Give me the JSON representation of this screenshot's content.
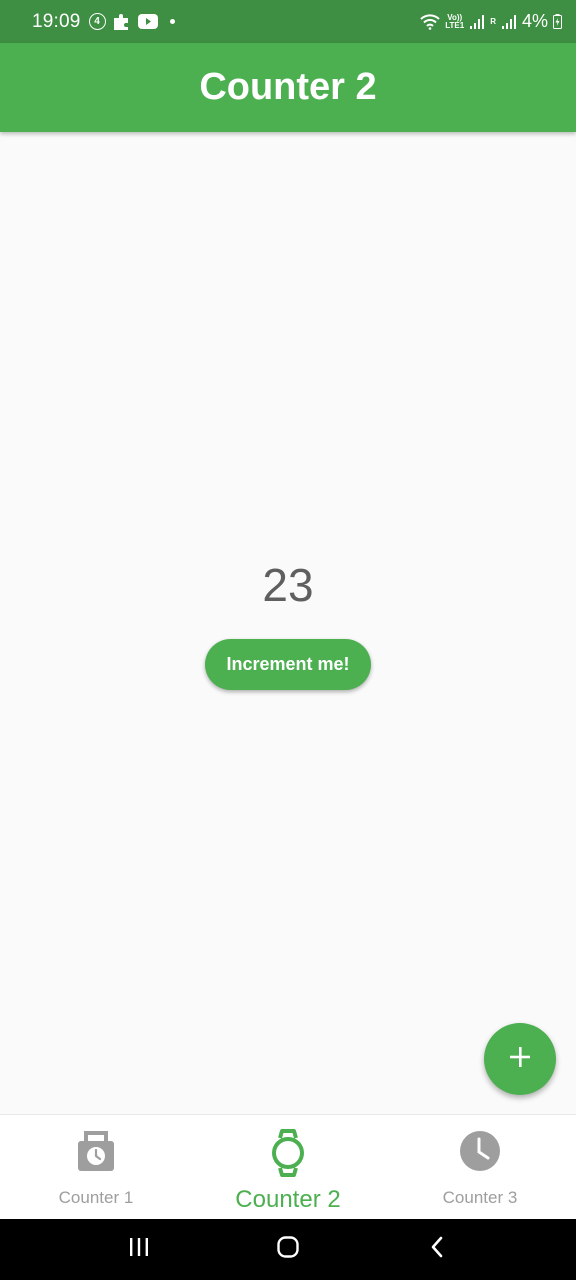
{
  "status_bar": {
    "time": "19:09",
    "notification_count": "4",
    "network_label_top": "Vo))",
    "network_label_bottom": "LTE1",
    "roaming_label": "R",
    "battery": "4%"
  },
  "app_bar": {
    "title": "Counter 2"
  },
  "main": {
    "counter_value": "23",
    "increment_label": "Increment me!"
  },
  "fab": {
    "icon": "plus-icon"
  },
  "bottom_nav": {
    "items": [
      {
        "label": "Counter 1",
        "icon": "briefcase-clock-icon",
        "active": false
      },
      {
        "label": "Counter 2",
        "icon": "watch-icon",
        "active": true
      },
      {
        "label": "Counter 3",
        "icon": "clock-icon",
        "active": false
      }
    ]
  },
  "colors": {
    "primary": "#4caf50",
    "status_bar": "#3e8f43",
    "inactive": "#9e9e9e",
    "background": "#fafafa"
  }
}
